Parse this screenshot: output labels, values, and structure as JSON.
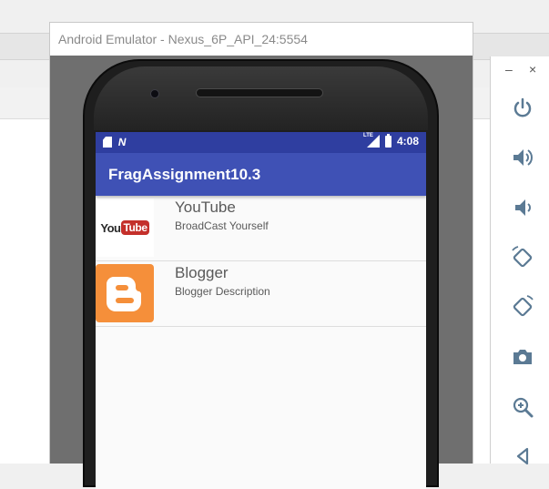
{
  "emulator": {
    "window_title": "Android Emulator - Nexus_6P_API_24:5554"
  },
  "status_bar": {
    "time": "4:08",
    "network_label": "LTE",
    "icons": [
      "sd-card-icon",
      "n-notification-icon",
      "lte-signal-icon",
      "battery-icon"
    ]
  },
  "app": {
    "title": "FragAssignment10.3",
    "items": [
      {
        "title": "YouTube",
        "description": "BroadCast Yourself",
        "logo_text_1": "You",
        "logo_text_2": "Tube",
        "icon": "youtube-logo"
      },
      {
        "title": "Blogger",
        "description": "Blogger Description",
        "icon": "blogger-logo"
      }
    ]
  },
  "side_panel": {
    "minimize": "–",
    "close": "×",
    "tools": [
      "power-icon",
      "volume-up-icon",
      "volume-down-icon",
      "rotate-left-icon",
      "rotate-right-icon",
      "camera-icon",
      "zoom-icon",
      "back-icon"
    ]
  },
  "colors": {
    "status_bar": "#2f3ea0",
    "app_bar": "#3f51b5",
    "youtube_red": "#c4302b",
    "blogger_orange": "#f58f3a",
    "side_icon": "#5b7a94"
  }
}
